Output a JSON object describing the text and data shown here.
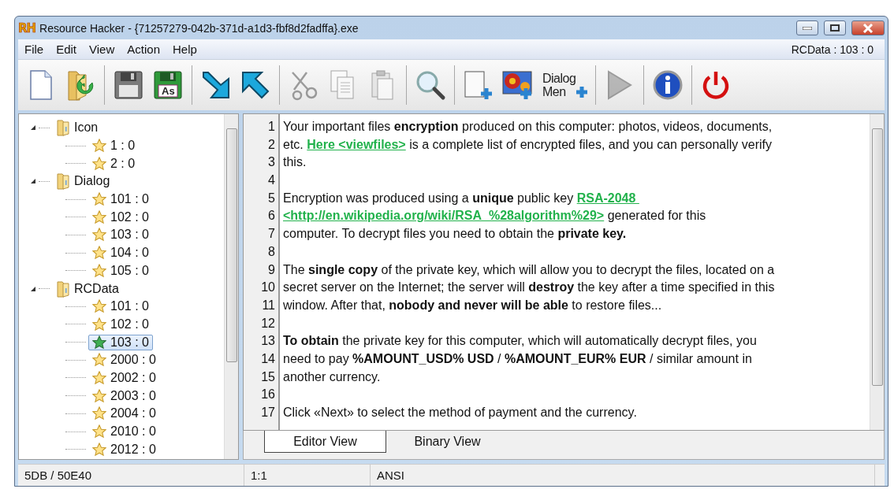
{
  "window": {
    "title": "Resource Hacker - {71257279-042b-371d-a1d3-fbf8d2fadffa}.exe",
    "logo": "RH"
  },
  "menu": {
    "items": [
      "File",
      "Edit",
      "View",
      "Action",
      "Help"
    ],
    "current_resource": "RCData : 103 : 0"
  },
  "toolbar": [
    {
      "kind": "new",
      "disabled": false
    },
    {
      "kind": "open",
      "disabled": false
    },
    {
      "kind": "separator"
    },
    {
      "kind": "save",
      "disabled": false
    },
    {
      "kind": "save-as",
      "label": "As",
      "disabled": false
    },
    {
      "kind": "separator"
    },
    {
      "kind": "import",
      "disabled": false
    },
    {
      "kind": "export",
      "disabled": false
    },
    {
      "kind": "separator"
    },
    {
      "kind": "cut",
      "disabled": true
    },
    {
      "kind": "copy",
      "disabled": true
    },
    {
      "kind": "paste",
      "disabled": true
    },
    {
      "kind": "separator"
    },
    {
      "kind": "find",
      "disabled": false
    },
    {
      "kind": "separator"
    },
    {
      "kind": "add-blank",
      "disabled": false
    },
    {
      "kind": "add-image",
      "disabled": false
    },
    {
      "kind": "dialog-menu",
      "label": [
        "Dialog",
        "Men"
      ],
      "disabled": false
    },
    {
      "kind": "separator"
    },
    {
      "kind": "run",
      "disabled": true
    },
    {
      "kind": "separator"
    },
    {
      "kind": "info",
      "disabled": false
    },
    {
      "kind": "separator"
    },
    {
      "kind": "exit",
      "disabled": false
    }
  ],
  "tree": [
    {
      "label": "Icon",
      "expanded": true,
      "children": [
        {
          "label": "1 : 0",
          "selected": false
        },
        {
          "label": "2 : 0",
          "selected": false
        }
      ]
    },
    {
      "label": "Dialog",
      "expanded": true,
      "children": [
        {
          "label": "101 : 0",
          "selected": false
        },
        {
          "label": "102 : 0",
          "selected": false
        },
        {
          "label": "103 : 0",
          "selected": false
        },
        {
          "label": "104 : 0",
          "selected": false
        },
        {
          "label": "105 : 0",
          "selected": false
        }
      ]
    },
    {
      "label": "RCData",
      "expanded": true,
      "children": [
        {
          "label": "101 : 0",
          "selected": false
        },
        {
          "label": "102 : 0",
          "selected": false
        },
        {
          "label": "103 : 0",
          "selected": true
        },
        {
          "label": "2000 : 0",
          "selected": false
        },
        {
          "label": "2002 : 0",
          "selected": false
        },
        {
          "label": "2003 : 0",
          "selected": false
        },
        {
          "label": "2004 : 0",
          "selected": false
        },
        {
          "label": "2010 : 0",
          "selected": false
        },
        {
          "label": "2012 : 0",
          "selected": false
        }
      ]
    }
  ],
  "editor": {
    "lines": [
      {
        "number": "1",
        "segments": [
          {
            "kind": "text",
            "text": "Your important files **encryption** produced on this computer: photos, videos, documents,"
          }
        ]
      },
      {
        "number": "2",
        "segments": [
          {
            "kind": "text",
            "text": "etc."
          },
          {
            "kind": "link",
            "text": "Here <viewfiles>"
          },
          {
            "kind": "text",
            "text": "is a complete list of encrypted files, and you can personally verify"
          }
        ]
      },
      {
        "number": "3",
        "segments": [
          {
            "kind": "text",
            "text": "this."
          }
        ]
      },
      {
        "number": "4"
      },
      {
        "number": "5",
        "segments": [
          {
            "kind": "text",
            "text": "Encryption was produced using a **unique** public key"
          },
          {
            "kind": "link",
            "text": "RSA-2048 "
          }
        ]
      },
      {
        "number": "6",
        "segments": [
          {
            "kind": "link",
            "text": "<http://en.wikipedia.org/wiki/RSA_%28algorithm%29>"
          },
          {
            "kind": "text",
            "text": "generated for this"
          }
        ]
      },
      {
        "number": "7",
        "segments": [
          {
            "kind": "text",
            "text": "computer. To decrypt files you need to obtain the **private key.**"
          }
        ]
      },
      {
        "number": "8"
      },
      {
        "number": "9",
        "segments": [
          {
            "kind": "text",
            "text": "The **single copy** of the private key, which will allow you to decrypt the files, located on a"
          }
        ]
      },
      {
        "number": "10",
        "segments": [
          {
            "kind": "text",
            "text": "secret server on the Internet; the server will **destroy** the key after a time specified in this"
          }
        ]
      },
      {
        "number": "11",
        "segments": [
          {
            "kind": "text",
            "text": "window. After that, **nobody and never will be able** to restore files..."
          }
        ]
      },
      {
        "number": "12"
      },
      {
        "number": "13",
        "segments": [
          {
            "kind": "text",
            "text": "**To obtain** the private key for this computer, which will automatically decrypt files, you"
          }
        ]
      },
      {
        "number": "14",
        "segments": [
          {
            "kind": "text",
            "text": "need to pay **%AMOUNT_USD% USD** / **%AMOUNT_EUR% EUR** / similar amount in"
          }
        ]
      },
      {
        "number": "15",
        "segments": [
          {
            "kind": "text",
            "text": "another currency."
          }
        ]
      },
      {
        "number": "16"
      },
      {
        "number": "17",
        "segments": [
          {
            "kind": "text",
            "text": "Click «Next» to select the method of payment and the currency."
          }
        ]
      }
    ]
  },
  "view_tabs": [
    {
      "label": "Editor View",
      "selected": true
    },
    {
      "label": "Binary View",
      "selected": false
    }
  ],
  "status_bar": [
    "5DB / 50E40",
    "1:1",
    "ANSI"
  ]
}
